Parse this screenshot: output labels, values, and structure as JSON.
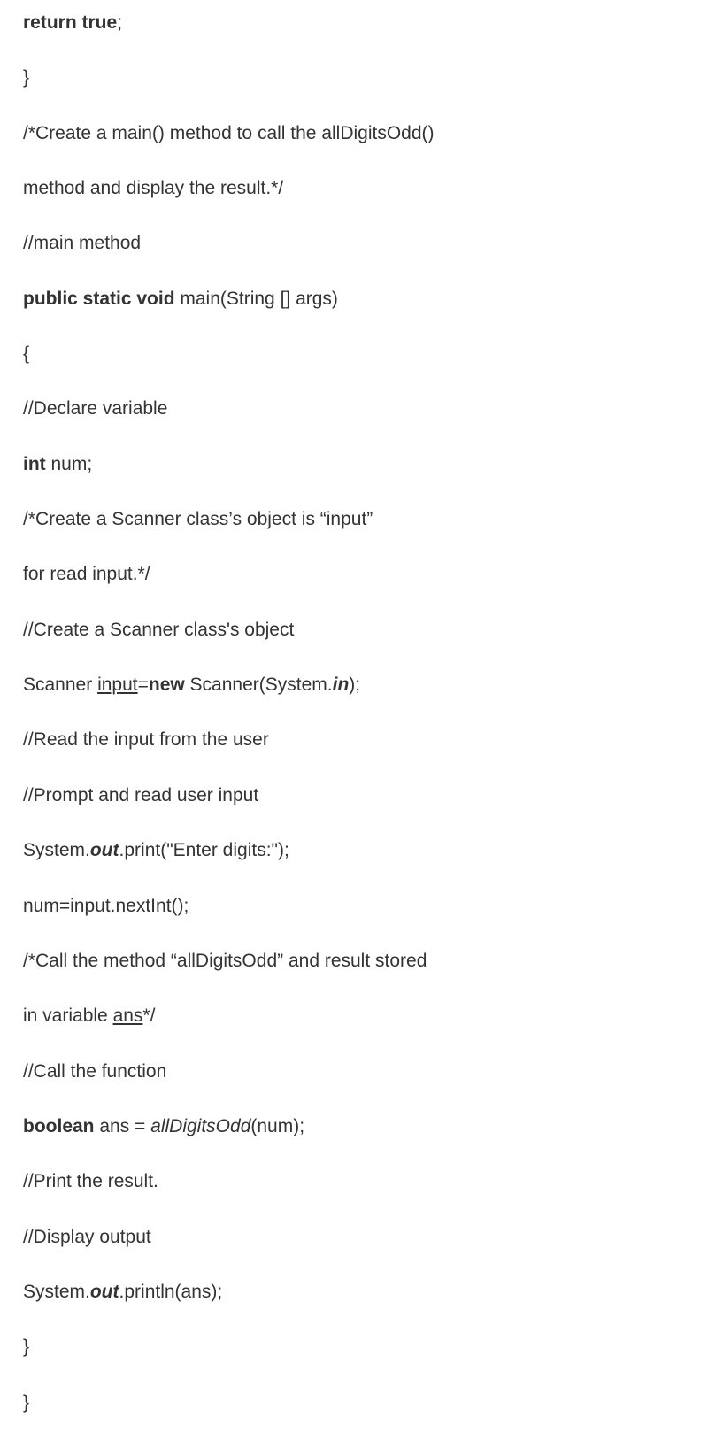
{
  "lines": [
    {
      "kind": "return_true"
    },
    {
      "text": "}"
    },
    {
      "text": "/*Create a main() method to call the allDigitsOdd()"
    },
    {
      "text": "method and display the result.*/"
    },
    {
      "text": "//main method"
    },
    {
      "kind": "main_signature"
    },
    {
      "text": "{"
    },
    {
      "text": "//Declare variable"
    },
    {
      "kind": "int_num"
    },
    {
      "text": "/*Create a Scanner class’s object is “input”"
    },
    {
      "text": "for read input.*/"
    },
    {
      "text": "//Create a Scanner class's object"
    },
    {
      "kind": "scanner_decl"
    },
    {
      "text": "//Read the input from the user"
    },
    {
      "text": "//Prompt and read user input"
    },
    {
      "kind": "sys_out_print"
    },
    {
      "text": "num=input.nextInt();"
    },
    {
      "text": "/*Call the method “allDigitsOdd” and result stored"
    },
    {
      "kind": "in_variable_ans"
    },
    {
      "text": "//Call the function"
    },
    {
      "kind": "boolean_ans"
    },
    {
      "text": "//Print the result."
    },
    {
      "text": "//Display output"
    },
    {
      "kind": "sys_out_println"
    },
    {
      "text": "}"
    },
    {
      "text": "}"
    }
  ],
  "tokens": {
    "return_true": {
      "t0": "return true",
      "t1": ";"
    },
    "main_signature": {
      "t0": "public static void",
      "t1": " main(String [] args)"
    },
    "int_num": {
      "t0": "int",
      "t1": " num;"
    },
    "scanner_decl": {
      "t0": "Scanner ",
      "t1": "input",
      "t2": "=",
      "t3": "new",
      "t4": " Scanner(System.",
      "t5": "in",
      "t6": ");"
    },
    "sys_out_print": {
      "t0": "System.",
      "t1": "out",
      "t2": ".print(\"Enter digits:\");"
    },
    "in_variable_ans": {
      "t0": "in variable ",
      "t1": "ans",
      "t2": "*/"
    },
    "boolean_ans": {
      "t0": "boolean",
      "t1": " ans = ",
      "t2": "allDigitsOdd",
      "t3": "(num);"
    },
    "sys_out_println": {
      "t0": "System.",
      "t1": "out",
      "t2": ".println(ans);"
    }
  }
}
